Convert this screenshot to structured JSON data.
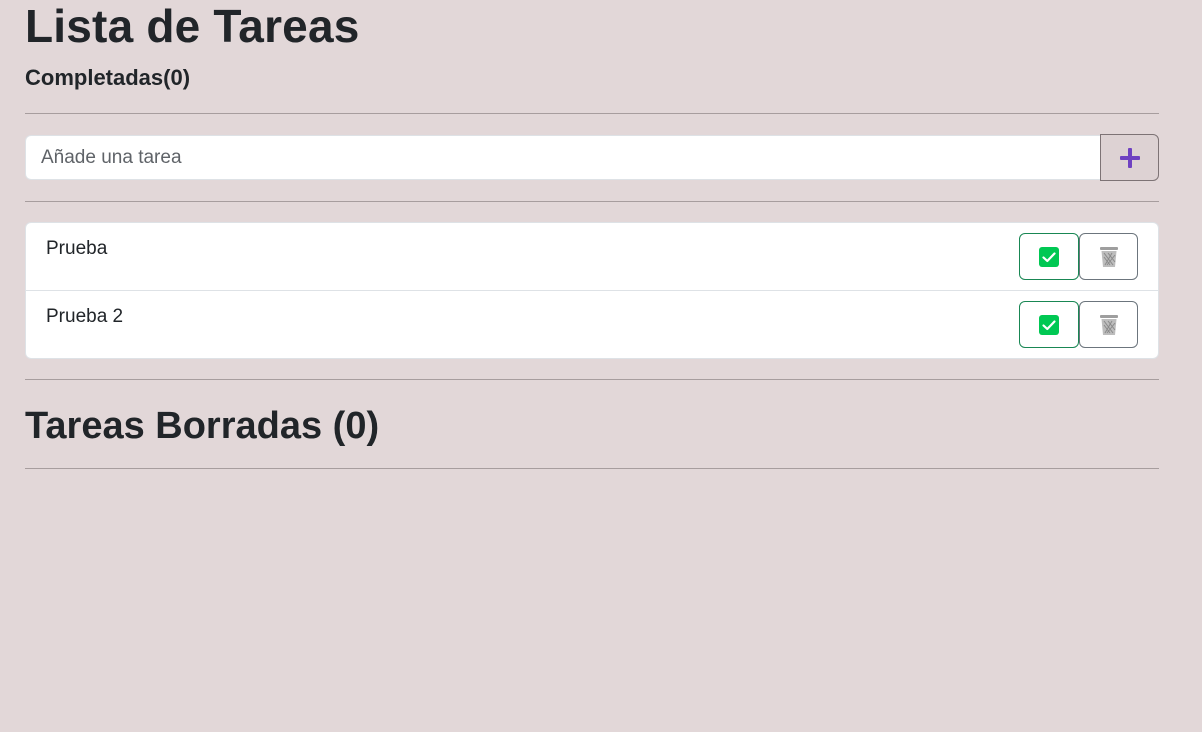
{
  "header": {
    "title": "Lista de Tareas",
    "completed_label": "Completadas(0)"
  },
  "add_task": {
    "placeholder": "Añade una tarea",
    "value": "",
    "button_icon": "plus-icon",
    "button_icon_color": "#6f42c1"
  },
  "tasks": [
    {
      "label": "Prueba"
    },
    {
      "label": "Prueba 2"
    }
  ],
  "task_actions": {
    "complete_icon": "check-square-icon",
    "complete_color": "#00c853",
    "delete_icon": "trash-icon",
    "delete_color": "#9e9e9e"
  },
  "deleted_section": {
    "title": "Tareas Borradas (0)"
  },
  "colors": {
    "background": "#e2d7d8",
    "card": "#ffffff"
  }
}
